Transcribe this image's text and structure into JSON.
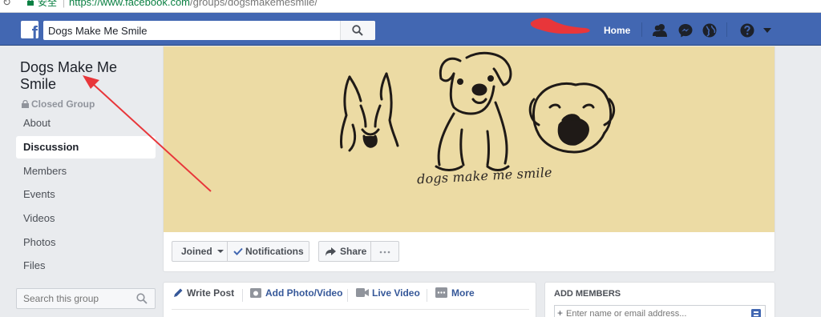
{
  "browser": {
    "secure_label": "安全",
    "url_host": "https://www.facebook.com",
    "url_path": "/groups/dogsmakemesmile/"
  },
  "topbar": {
    "logo": "f",
    "search_value": "Dogs Make Me Smile",
    "home_label": "Home",
    "icons": [
      "friends-icon",
      "messenger-icon",
      "globe-icon",
      "help-icon",
      "caret-down-icon"
    ]
  },
  "group": {
    "name": "Dogs Make Me Smile",
    "privacy": "Closed Group"
  },
  "sidebar": {
    "items": [
      {
        "label": "About"
      },
      {
        "label": "Discussion"
      },
      {
        "label": "Members"
      },
      {
        "label": "Events"
      },
      {
        "label": "Videos"
      },
      {
        "label": "Photos"
      },
      {
        "label": "Files"
      }
    ],
    "active": "Discussion",
    "search_placeholder": "Search this group"
  },
  "cover": {
    "text": "dogs make me smile",
    "background": "#ecdba4"
  },
  "actions": {
    "joined": "Joined",
    "notifications": "Notifications",
    "share": "Share",
    "more": "···"
  },
  "composer": {
    "tabs": [
      "Write Post",
      "Add Photo/Video",
      "Live Video",
      "More"
    ]
  },
  "add_members": {
    "title": "ADD MEMBERS",
    "placeholder": "Enter name or email address..."
  },
  "colors": {
    "brand_blue": "#4267b2",
    "link_blue": "#365899",
    "annotation_red": "#e8363a"
  }
}
